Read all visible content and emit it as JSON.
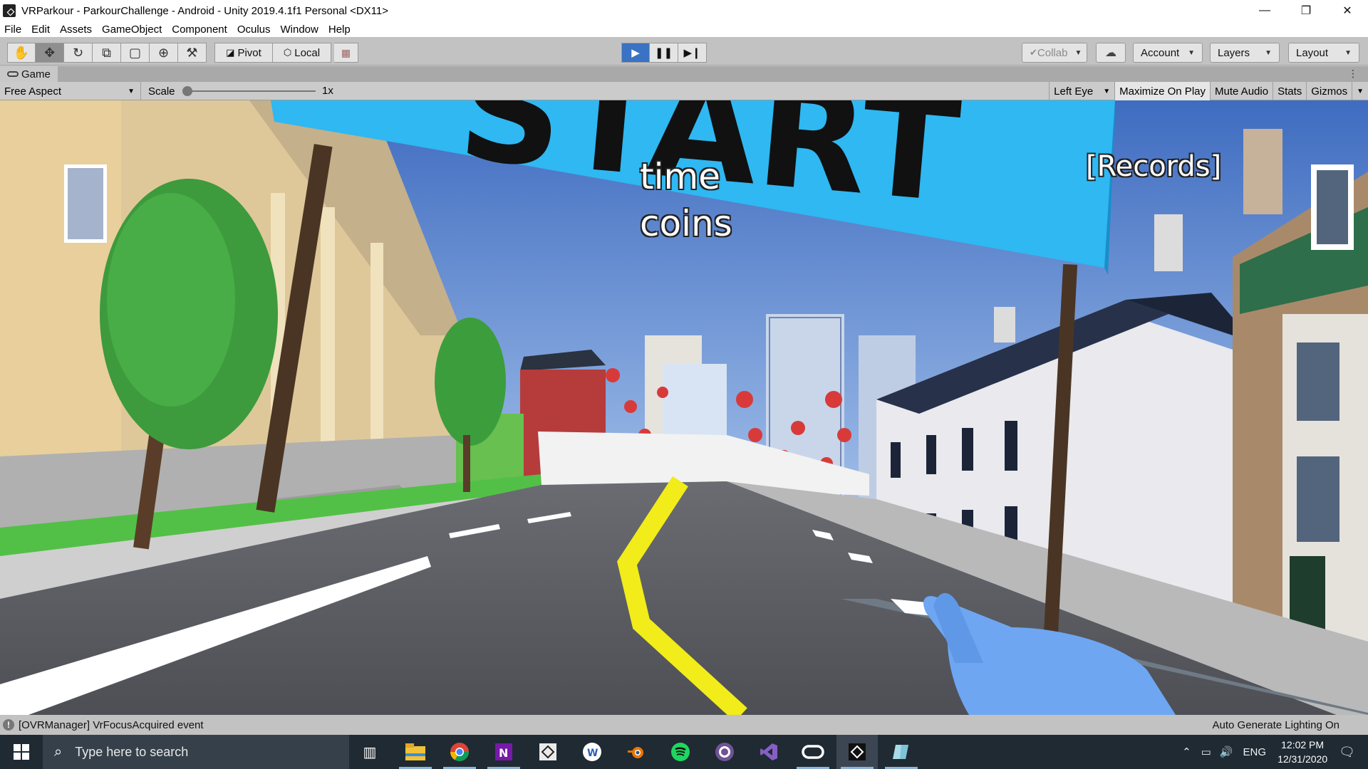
{
  "window": {
    "title": "VRParkour - ParkourChallenge - Android - Unity 2019.4.1f1 Personal <DX11>",
    "controls": [
      "minimize-icon",
      "maximize-icon",
      "close-icon"
    ]
  },
  "menu": [
    "File",
    "Edit",
    "Assets",
    "GameObject",
    "Component",
    "Oculus",
    "Window",
    "Help"
  ],
  "toolbar": {
    "tools": [
      "hand-icon",
      "move-icon",
      "rotate-icon",
      "scale-icon",
      "rect-transform-icon",
      "transform-icon",
      "custom-tool-icon"
    ],
    "active_tool": "move-icon",
    "pivot_label": "Pivot",
    "local_label": "Local",
    "collab_label": "Collab",
    "account_label": "Account",
    "layers_label": "Layers",
    "layout_label": "Layout",
    "play_state": "playing"
  },
  "game_tab": {
    "label": "Game",
    "aspect": "Free Aspect",
    "scale_label": "Scale",
    "scale_value": "1x",
    "eye": "Left Eye",
    "maximize_on_play": "Maximize On Play",
    "mute_audio": "Mute Audio",
    "stats": "Stats",
    "gizmos": "Gizmos"
  },
  "game_view": {
    "sign_text": "START",
    "hud_time": "time",
    "hud_coins": "coins",
    "hud_records": "[Records]",
    "colors": {
      "sky": "#4a78c8",
      "sign": "#2fb8f2",
      "road": "#5b5d62",
      "grass": "#52c046",
      "hand": "#6ea6f2"
    }
  },
  "status": {
    "message": "[OVRManager] VrFocusAcquired event",
    "lighting": "Auto Generate Lighting On"
  },
  "taskbar": {
    "search_placeholder": "Type here to search",
    "apps": [
      "task-view-icon",
      "file-explorer-icon",
      "chrome-icon",
      "onenote-icon",
      "unity-hub-icon",
      "wordpad-icon",
      "blender-icon",
      "spotify-icon",
      "github-icon",
      "visual-studio-icon",
      "oculus-icon",
      "unity-icon",
      "unity-tool-icon"
    ],
    "language": "ENG",
    "time": "12:02 PM",
    "date": "12/31/2020"
  }
}
